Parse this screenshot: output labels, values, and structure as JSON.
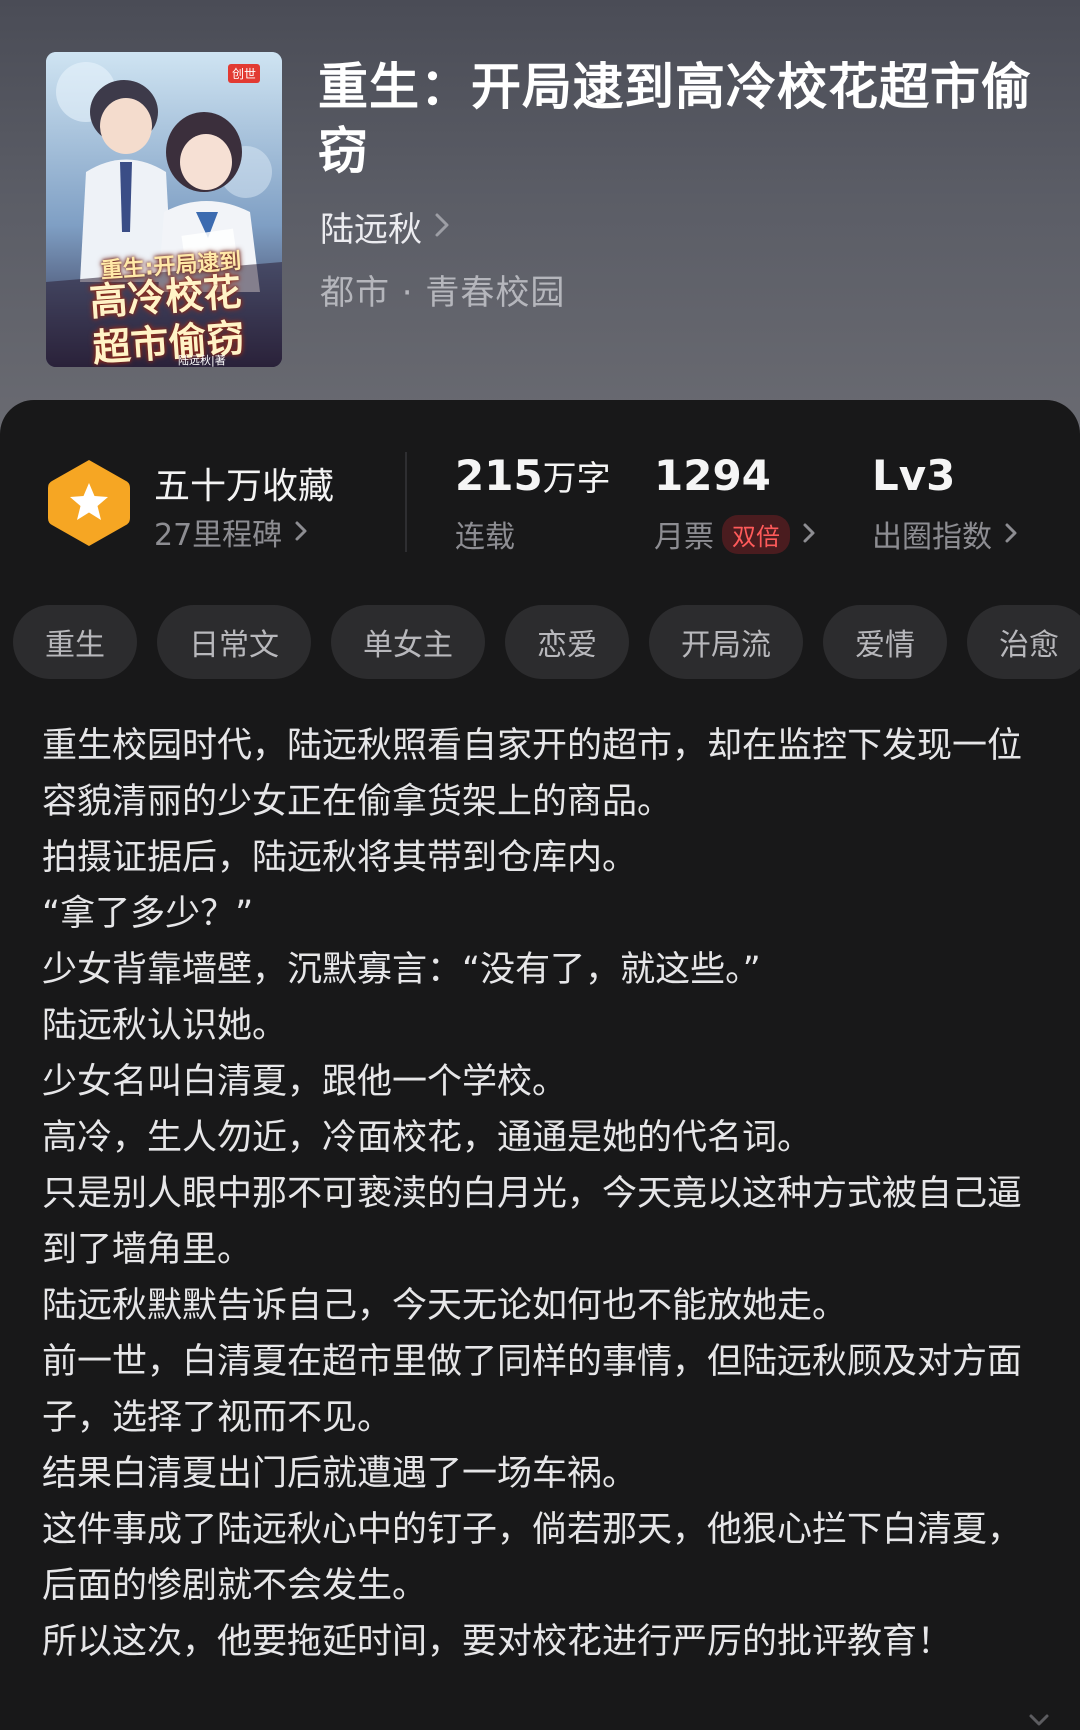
{
  "book": {
    "title": "重生：开局逮到高冷校花超市偷窃",
    "author": "陆远秋",
    "genre": "都市 · 青春校园",
    "cover": {
      "publisher_mark": "创世",
      "title_line1": "重生:开局逮到",
      "title_line2": "高冷校花",
      "title_line3": "超市偷窃",
      "author_text": "陆远秋|著"
    }
  },
  "stats": {
    "collect_title": "五十万收藏",
    "collect_sub": "27里程碑",
    "words_num": "215",
    "words_unit": "万字",
    "words_label": "连载",
    "tickets_num": "1294",
    "tickets_label": "月票",
    "tickets_badge": "双倍",
    "level_num": "Lv3",
    "level_label": "出圈指数"
  },
  "tags": [
    "重生",
    "日常文",
    "单女主",
    "恋爱",
    "开局流",
    "爱情",
    "治愈"
  ],
  "synopsis": [
    "重生校园时代，陆远秋照看自家开的超市，却在监控下发现一位容貌清丽的少女正在偷拿货架上的商品。",
    "拍摄证据后，陆远秋将其带到仓库内。",
    "“拿了多少？”",
    "少女背靠墙壁，沉默寡言：“没有了，就这些。”",
    "陆远秋认识她。",
    "少女名叫白清夏，跟他一个学校。",
    "高冷，生人勿近，冷面校花，通通是她的代名词。",
    "只是别人眼中那不可亵渎的白月光，今天竟以这种方式被自己逼到了墙角里。",
    "陆远秋默默告诉自己，今天无论如何也不能放她走。",
    "前一世，白清夏在超市里做了同样的事情，但陆远秋顾及对方面子，选择了视而不见。",
    "结果白清夏出门后就遭遇了一场车祸。",
    "这件事成了陆远秋心中的钉子，倘若那天，他狠心拦下白清夏，后面的惨剧就不会发生。",
    "所以这次，他要拖延时间，要对校花进行严厉的批评教育！"
  ],
  "icons": {
    "collect": "star-hexagon-icon",
    "chevron": "chevron-right-icon",
    "expand": "chevron-down-icon"
  },
  "colors": {
    "accent_orange": "#f6a623",
    "badge_red": "#ff5a5a",
    "panel_bg": "#181819"
  }
}
